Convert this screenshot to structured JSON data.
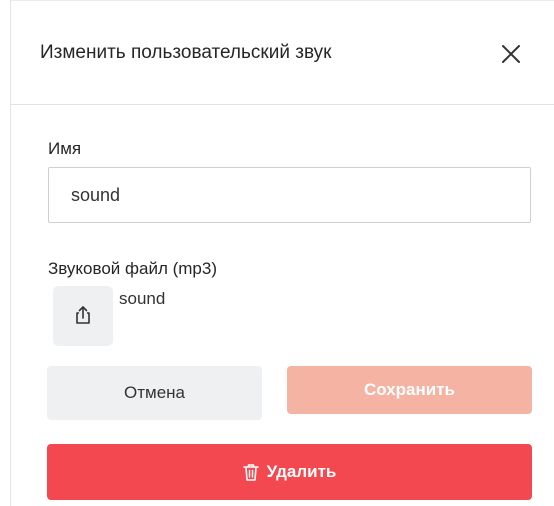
{
  "dialog": {
    "title": "Изменить пользовательский звук",
    "close_icon": "close-icon"
  },
  "name_field": {
    "label": "Имя",
    "value": "sound"
  },
  "sound_file": {
    "label": "Звуковой файл (mp3)",
    "upload_icon": "upload-icon",
    "file_name": "sound"
  },
  "actions": {
    "cancel_label": "Отмена",
    "save_label": "Сохранить",
    "delete_label": "Удалить",
    "delete_icon": "trash-icon"
  },
  "colors": {
    "delete_button": "#f44850",
    "save_button_disabled": "#f5b3a3",
    "secondary_button": "#eef0f2"
  }
}
